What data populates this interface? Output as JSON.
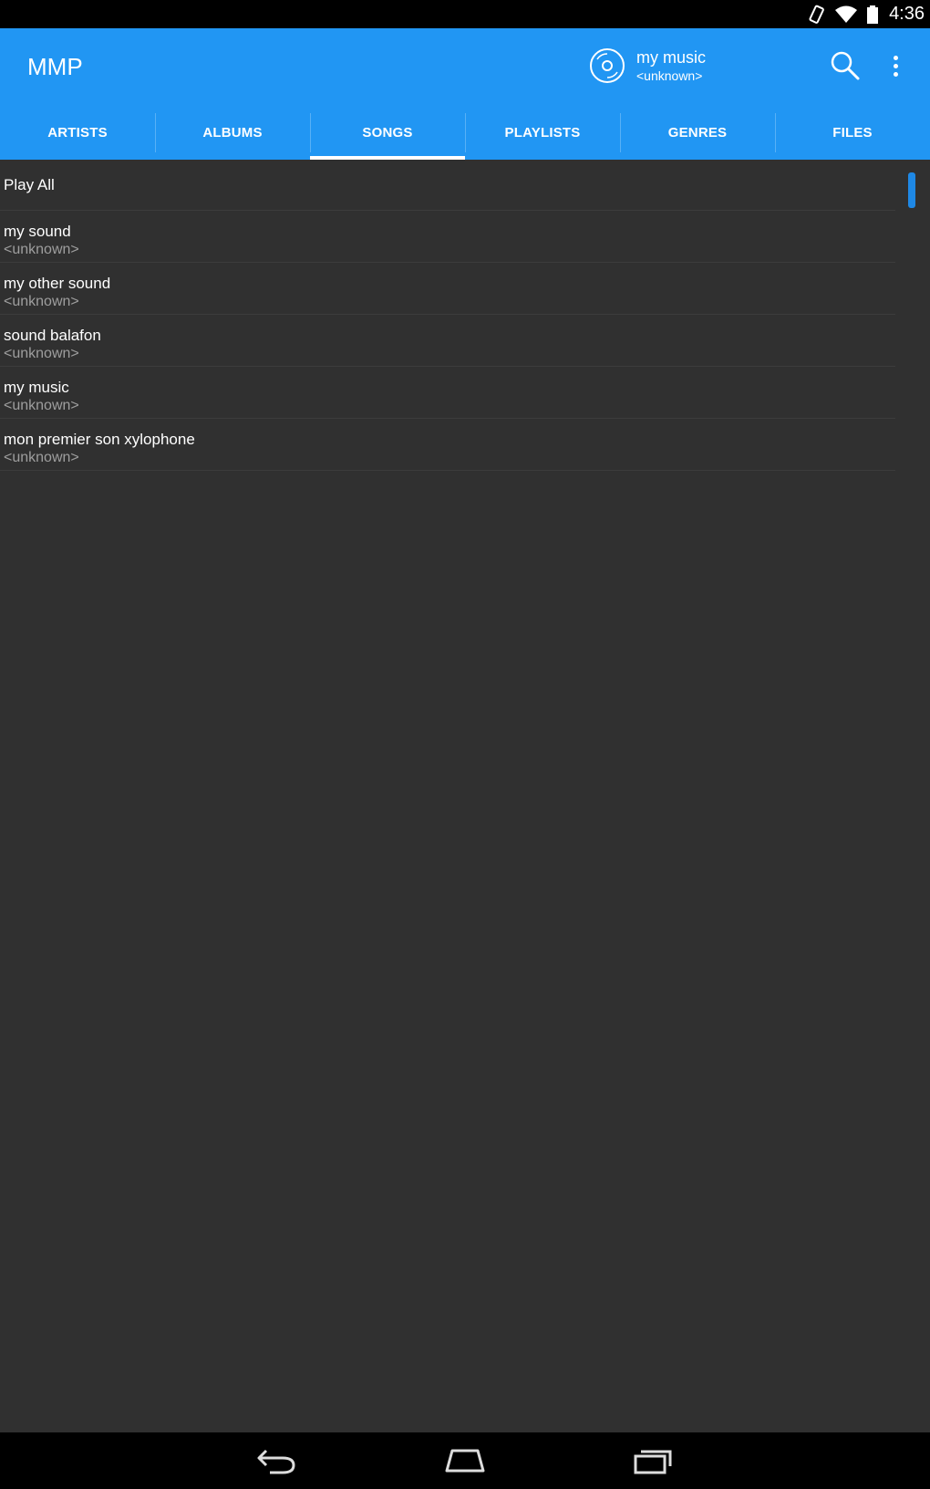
{
  "status_bar": {
    "time": "4:36",
    "icons": [
      "screen-rotation-icon",
      "wifi-icon",
      "battery-icon"
    ]
  },
  "app_bar": {
    "title": "MMP",
    "background_color": "#2196f3",
    "now_playing": {
      "icon": "disc-icon",
      "title": "my music",
      "subtitle": "<unknown>"
    },
    "actions": [
      "search-icon",
      "overflow-menu-icon"
    ]
  },
  "tabs": [
    {
      "label": "ARTISTS",
      "active": false
    },
    {
      "label": "ALBUMS",
      "active": false
    },
    {
      "label": "SONGS",
      "active": true
    },
    {
      "label": "PLAYLISTS",
      "active": false
    },
    {
      "label": "GENRES",
      "active": false
    },
    {
      "label": "FILES",
      "active": false
    }
  ],
  "list": {
    "play_all_label": "Play All",
    "songs": [
      {
        "title": "my sound",
        "artist": "<unknown>"
      },
      {
        "title": "my other sound",
        "artist": "<unknown>"
      },
      {
        "title": "sound balafon",
        "artist": "<unknown>"
      },
      {
        "title": "my music",
        "artist": "<unknown>"
      },
      {
        "title": "mon premier son xylophone",
        "artist": "<unknown>"
      }
    ]
  },
  "nav_bar": {
    "buttons": [
      "back-icon",
      "home-icon",
      "recents-icon"
    ]
  }
}
